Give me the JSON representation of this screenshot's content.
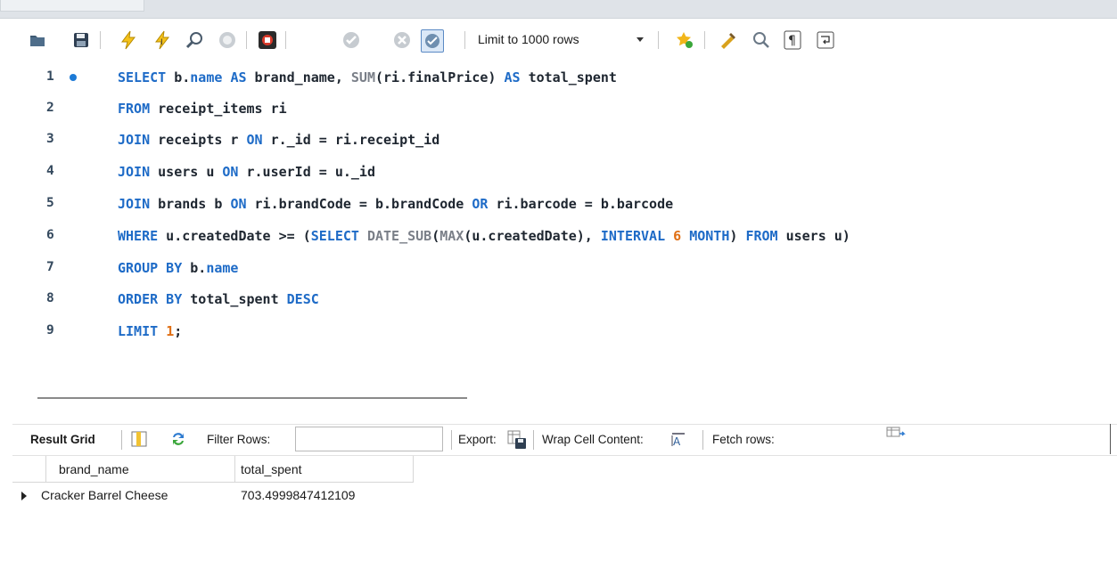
{
  "toolbar": {
    "limit_label": "Limit to 1000 rows",
    "icons": [
      "open-folder-icon",
      "save-icon",
      "execute-icon",
      "execute-current-icon",
      "explain-icon",
      "stop-icon",
      "toggle-output-icon",
      "commit-icon",
      "rollback-icon",
      "autocommit-icon",
      "beautify-icon",
      "find-icon",
      "invisible-chars-icon",
      "word-wrap-icon",
      "bookmark-icon"
    ]
  },
  "editor": {
    "lines": [
      {
        "n": "1"
      },
      {
        "n": "2"
      },
      {
        "n": "3"
      },
      {
        "n": "4"
      },
      {
        "n": "5"
      },
      {
        "n": "6"
      },
      {
        "n": "7"
      },
      {
        "n": "8"
      },
      {
        "n": "9"
      }
    ],
    "code": {
      "l1": {
        "k1": "SELECT",
        "t1": " b.",
        "k2": "name",
        "t2": " ",
        "k3": "AS",
        "t3": " brand_name, ",
        "f1": "SUM",
        "t4": "(ri.finalPrice) ",
        "k4": "AS",
        "t5": " total_spent"
      },
      "l2": {
        "k1": "FROM",
        "t1": " receipt_items ri"
      },
      "l3": {
        "k1": "JOIN",
        "t1": " receipts r ",
        "k2": "ON",
        "t2": " r._id = ri.receipt_id"
      },
      "l4": {
        "k1": "JOIN",
        "t1": " users u ",
        "k2": "ON",
        "t2": " r.userId = u._id"
      },
      "l5": {
        "k1": "JOIN",
        "t1": " brands b ",
        "k2": "ON",
        "t2": " ri.brandCode = b.brandCode ",
        "k3": "OR",
        "t3": " ri.barcode = b.barcode"
      },
      "l6": {
        "k1": "WHERE",
        "t1": " u.createdDate >= (",
        "k2": "SELECT",
        "t2": " ",
        "f1": "DATE_SUB",
        "t3": "(",
        "f2": "MAX",
        "t4": "(u.createdDate), ",
        "k3": "INTERVAL",
        "t5": " ",
        "n1": "6",
        "t6": " ",
        "k4": "MONTH",
        "t7": ") ",
        "k5": "FROM",
        "t8": " users u)"
      },
      "l7": {
        "k1": "GROUP BY",
        "t1": " b.",
        "k2": "name"
      },
      "l8": {
        "k1": "ORDER BY",
        "t1": " total_spent ",
        "k2": "DESC"
      },
      "l9": {
        "k1": "LIMIT",
        "t1": " ",
        "n1": "1",
        "t2": ";"
      }
    }
  },
  "result_toolbar": {
    "result_grid": "Result Grid",
    "filter_rows": "Filter Rows:",
    "filter_value": "",
    "export": "Export:",
    "wrap": "Wrap Cell Content:",
    "fetch": "Fetch rows:"
  },
  "result_grid": {
    "columns": [
      "brand_name",
      "total_spent"
    ],
    "rows": [
      [
        "Cracker Barrel Cheese",
        "703.4999847412109"
      ]
    ]
  }
}
